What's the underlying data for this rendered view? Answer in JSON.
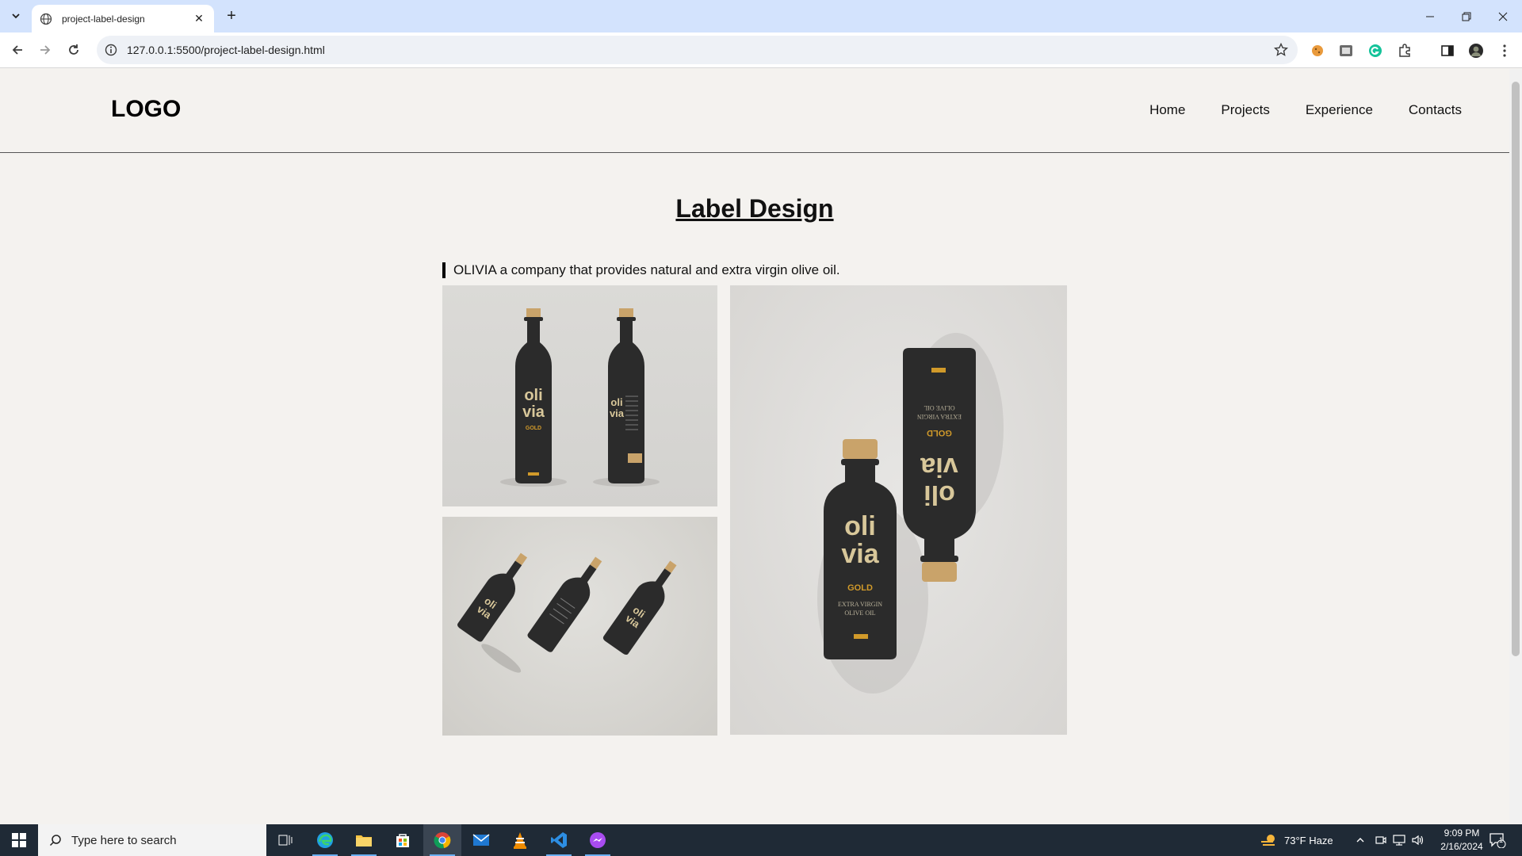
{
  "browser": {
    "tab_title": "project-label-design",
    "url": "127.0.0.1:5500/project-label-design.html",
    "new_tab_symbol": "+",
    "close_symbol": "✕"
  },
  "site": {
    "logo": "LOGO",
    "nav": [
      "Home",
      "Projects",
      "Experience",
      "Contacts"
    ]
  },
  "main": {
    "title": "Label Design",
    "description": "OLIVIA a company that provides natural and extra virgin olive oil."
  },
  "images": [
    {
      "name": "two-bottles-standing",
      "brand_lines": [
        "oli",
        "via"
      ],
      "label": "GOLD"
    },
    {
      "name": "three-bottles-lying-diagonal",
      "brand_lines": [
        "oli",
        "via"
      ]
    },
    {
      "name": "two-bottles-top-view",
      "brand_lines": [
        "oli",
        "via"
      ],
      "label": "GOLD",
      "sub": [
        "EXTRA VIRGIN",
        "OLIVE OIL"
      ]
    }
  ],
  "taskbar": {
    "search_placeholder": "Type here to search",
    "weather": "73°F  Haze",
    "time": "9:09 PM",
    "date": "2/16/2024",
    "notification_count": "1"
  },
  "colors": {
    "page_bg": "#f4f2ef",
    "tabstrip_bg": "#d3e3fd",
    "bottle": "#2b2b2b",
    "cork": "#c9a36a",
    "label_text": "#d8c79a",
    "gold": "#d19a2a"
  }
}
